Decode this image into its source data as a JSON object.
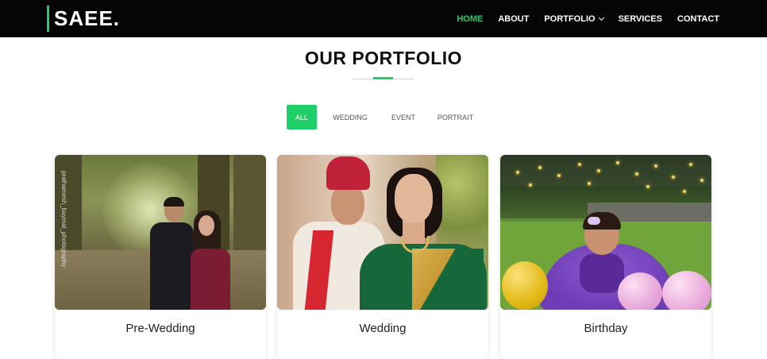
{
  "brand": {
    "logo_text": "SAEE.",
    "accent_color": "#1fcf6a"
  },
  "nav": {
    "items": [
      {
        "label": "HOME",
        "active": true
      },
      {
        "label": "ABOUT",
        "active": false
      },
      {
        "label": "PORTFOLIO",
        "active": false,
        "dropdown": true
      },
      {
        "label": "SERVICES",
        "active": false
      },
      {
        "label": "CONTACT",
        "active": false
      }
    ]
  },
  "section": {
    "title": "OUR PORTFOLIO"
  },
  "filters": [
    {
      "label": "ALL",
      "active": true
    },
    {
      "label": "WEDDING",
      "active": false
    },
    {
      "label": "EVENT",
      "active": false
    },
    {
      "label": "PORTRAIT",
      "active": false
    }
  ],
  "cards": [
    {
      "title": "Pre-Wedding",
      "image": "pre-wedding-couple-photo",
      "watermark": "prathamesh_baymal_photography"
    },
    {
      "title": "Wedding",
      "image": "wedding-couple-photo"
    },
    {
      "title": "Birthday",
      "image": "birthday-baby-with-balloons-photo"
    }
  ]
}
